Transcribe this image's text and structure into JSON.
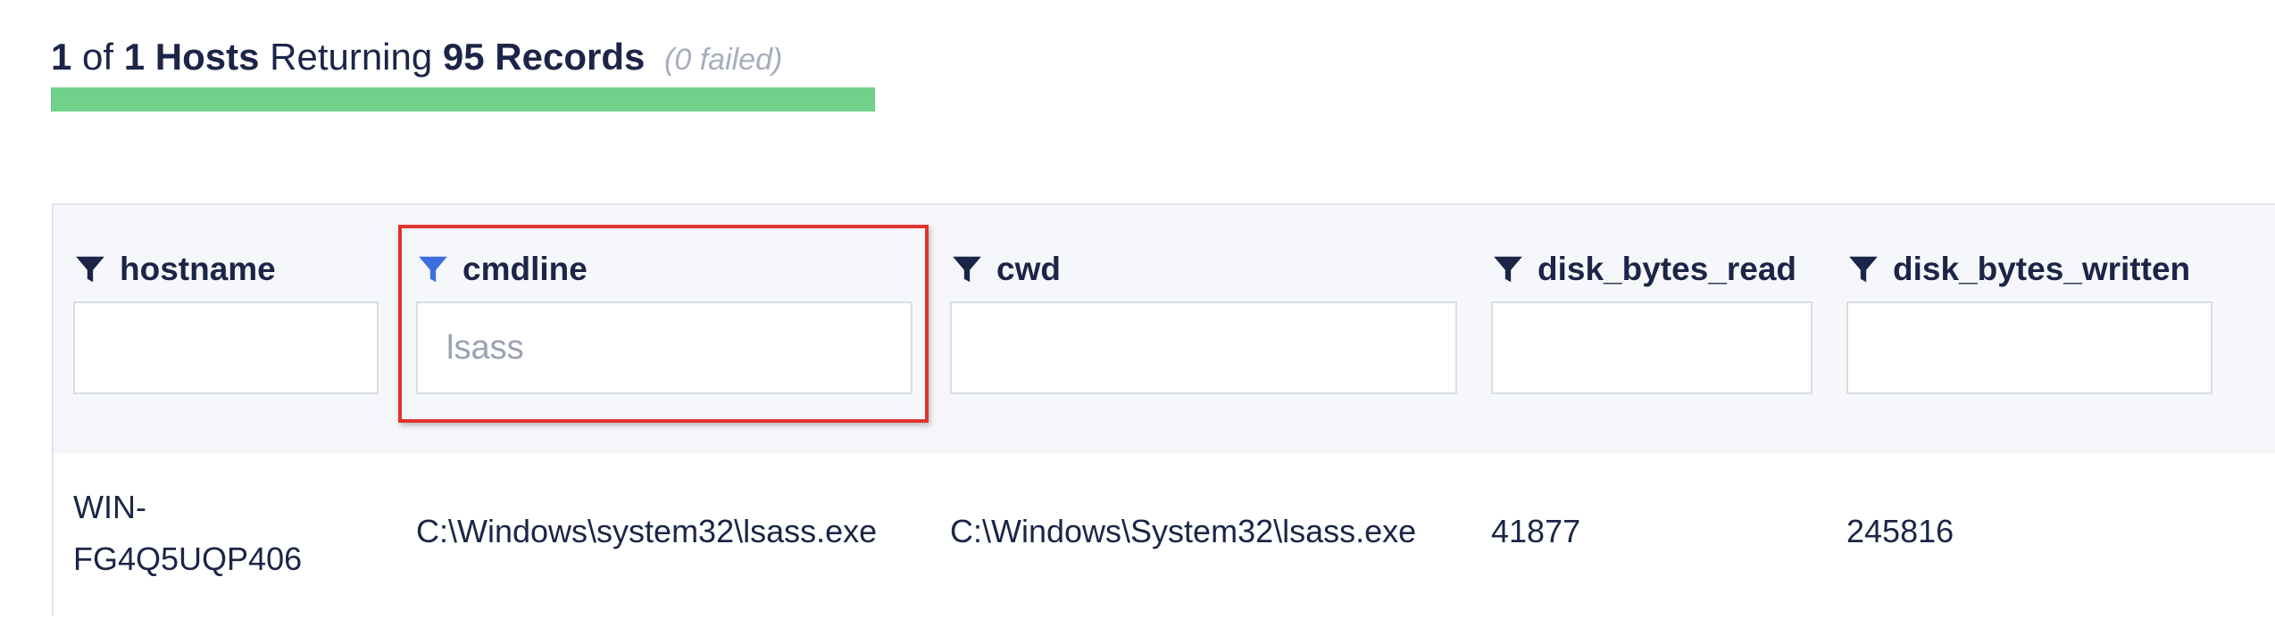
{
  "summary": {
    "hosts_returned": "1",
    "of_label": "of",
    "hosts_total": "1 Hosts",
    "returning_label": "Returning",
    "records": "95 Records",
    "failed": "(0 failed)",
    "progress_percent": 100
  },
  "table": {
    "columns": [
      {
        "label": "hostname",
        "filter_value": "",
        "filter_active": false
      },
      {
        "label": "cmdline",
        "filter_value": "lsass",
        "filter_active": true
      },
      {
        "label": "cwd",
        "filter_value": "",
        "filter_active": false
      },
      {
        "label": "disk_bytes_read",
        "filter_value": "",
        "filter_active": false
      },
      {
        "label": "disk_bytes_written",
        "filter_value": "",
        "filter_active": false
      }
    ],
    "rows": [
      {
        "hostname": "WIN-FG4Q5UQP406",
        "cmdline": "C:\\Windows\\system32\\lsass.exe",
        "cwd": "C:\\Windows\\System32\\lsass.exe",
        "disk_bytes_read": "41877",
        "disk_bytes_written": "245816"
      }
    ]
  },
  "colors": {
    "progress": "#6fd18a",
    "filter_active": "#3b6fe0",
    "filter_inactive": "#1c2547",
    "highlight": "#e0342c"
  },
  "icons": {
    "filter": "filter-icon"
  }
}
